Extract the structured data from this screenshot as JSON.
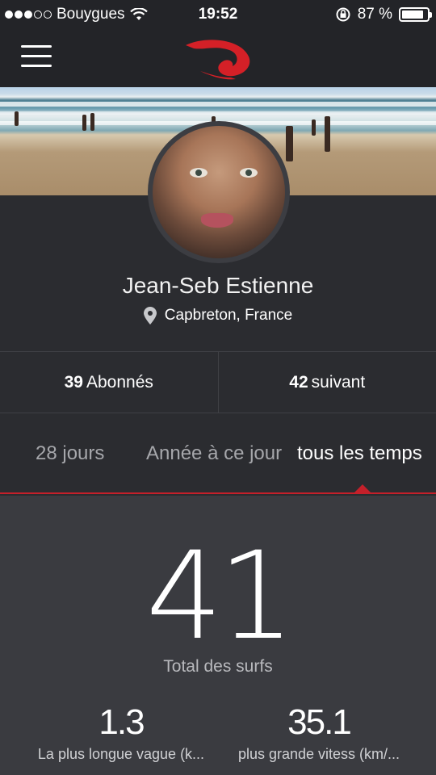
{
  "status_bar": {
    "carrier": "Bouygues",
    "time": "19:52",
    "battery_text": "87 %",
    "battery_level": 0.87
  },
  "nav": {
    "menu_icon": "hamburger-icon",
    "logo": "rip-curl-logo"
  },
  "profile": {
    "name": "Jean-Seb Estienne",
    "location": "Capbreton, France",
    "location_icon": "map-pin-icon"
  },
  "follow": {
    "followers_count": "39",
    "followers_label": "Abonnés",
    "following_count": "42",
    "following_label": "suivant"
  },
  "tabs": [
    {
      "label": "28 jours",
      "active": false
    },
    {
      "label": "Année à ce jour",
      "active": false
    },
    {
      "label": "tous les temps",
      "active": true
    }
  ],
  "stats": {
    "total_value": "41",
    "total_label": "Total des surfs",
    "items": [
      {
        "value": "1.3",
        "label": "La plus longue vague (k..."
      },
      {
        "value": "35.1",
        "label": "plus grande vitess (km/..."
      }
    ]
  },
  "colors": {
    "accent": "#c4202a",
    "background": "#2b2c30",
    "stats_background": "#3a3b40"
  }
}
